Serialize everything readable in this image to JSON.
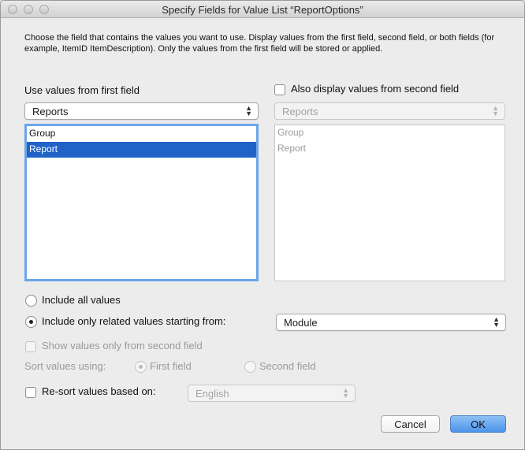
{
  "window": {
    "title": "Specify Fields for Value List “ReportOptions”"
  },
  "description": "Choose the field that contains the values you want to use.  Display values from the first field, second field, or both fields (for example, ItemID ItemDescription). Only the values from the first field will be stored or applied.",
  "first_field": {
    "heading": "Use values from first field",
    "table_popup": "Reports",
    "fields": [
      {
        "label": "Group",
        "selected": false
      },
      {
        "label": "Report",
        "selected": true
      }
    ]
  },
  "second_field": {
    "checkbox_label": "Also display values from second field",
    "checked": false,
    "table_popup": "Reports",
    "fields": [
      {
        "label": "Group"
      },
      {
        "label": "Report"
      }
    ]
  },
  "include": {
    "all_values_label": "Include all values",
    "related_values_label": "Include only related values starting from:",
    "selected": "related",
    "related_popup": "Module"
  },
  "show_second_only": {
    "label": "Show values only from second field",
    "checked": false,
    "enabled": false
  },
  "sort": {
    "label": "Sort values using:",
    "first_label": "First field",
    "second_label": "Second field",
    "selected": "first",
    "enabled": false
  },
  "resort": {
    "label": "Re-sort values based on:",
    "checked": false,
    "language_popup": "English"
  },
  "buttons": {
    "cancel": "Cancel",
    "ok": "OK"
  },
  "icons": {
    "popup_arrows": "⌃⌄",
    "close": "close-icon",
    "minimize": "minimize-icon",
    "zoom": "zoom-icon"
  },
  "colors": {
    "selection": "#1f63c9",
    "focus_ring": "#6aa6e8",
    "default_button": "#4c94ea"
  }
}
